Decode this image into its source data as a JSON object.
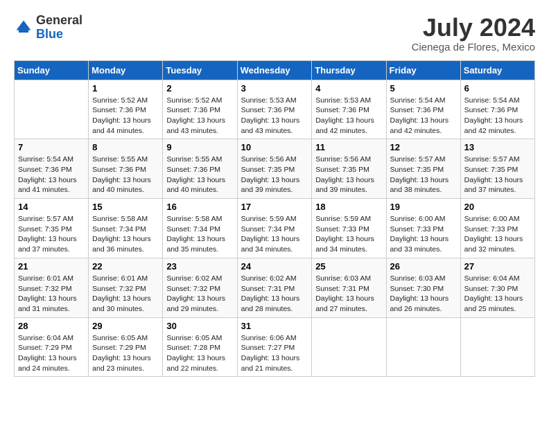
{
  "header": {
    "logo_general": "General",
    "logo_blue": "Blue",
    "month_year": "July 2024",
    "location": "Cienega de Flores, Mexico"
  },
  "days_of_week": [
    "Sunday",
    "Monday",
    "Tuesday",
    "Wednesday",
    "Thursday",
    "Friday",
    "Saturday"
  ],
  "weeks": [
    [
      {
        "num": "",
        "info": ""
      },
      {
        "num": "1",
        "info": "Sunrise: 5:52 AM\nSunset: 7:36 PM\nDaylight: 13 hours\nand 44 minutes."
      },
      {
        "num": "2",
        "info": "Sunrise: 5:52 AM\nSunset: 7:36 PM\nDaylight: 13 hours\nand 43 minutes."
      },
      {
        "num": "3",
        "info": "Sunrise: 5:53 AM\nSunset: 7:36 PM\nDaylight: 13 hours\nand 43 minutes."
      },
      {
        "num": "4",
        "info": "Sunrise: 5:53 AM\nSunset: 7:36 PM\nDaylight: 13 hours\nand 42 minutes."
      },
      {
        "num": "5",
        "info": "Sunrise: 5:54 AM\nSunset: 7:36 PM\nDaylight: 13 hours\nand 42 minutes."
      },
      {
        "num": "6",
        "info": "Sunrise: 5:54 AM\nSunset: 7:36 PM\nDaylight: 13 hours\nand 42 minutes."
      }
    ],
    [
      {
        "num": "7",
        "info": "Sunrise: 5:54 AM\nSunset: 7:36 PM\nDaylight: 13 hours\nand 41 minutes."
      },
      {
        "num": "8",
        "info": "Sunrise: 5:55 AM\nSunset: 7:36 PM\nDaylight: 13 hours\nand 40 minutes."
      },
      {
        "num": "9",
        "info": "Sunrise: 5:55 AM\nSunset: 7:36 PM\nDaylight: 13 hours\nand 40 minutes."
      },
      {
        "num": "10",
        "info": "Sunrise: 5:56 AM\nSunset: 7:35 PM\nDaylight: 13 hours\nand 39 minutes."
      },
      {
        "num": "11",
        "info": "Sunrise: 5:56 AM\nSunset: 7:35 PM\nDaylight: 13 hours\nand 39 minutes."
      },
      {
        "num": "12",
        "info": "Sunrise: 5:57 AM\nSunset: 7:35 PM\nDaylight: 13 hours\nand 38 minutes."
      },
      {
        "num": "13",
        "info": "Sunrise: 5:57 AM\nSunset: 7:35 PM\nDaylight: 13 hours\nand 37 minutes."
      }
    ],
    [
      {
        "num": "14",
        "info": "Sunrise: 5:57 AM\nSunset: 7:35 PM\nDaylight: 13 hours\nand 37 minutes."
      },
      {
        "num": "15",
        "info": "Sunrise: 5:58 AM\nSunset: 7:34 PM\nDaylight: 13 hours\nand 36 minutes."
      },
      {
        "num": "16",
        "info": "Sunrise: 5:58 AM\nSunset: 7:34 PM\nDaylight: 13 hours\nand 35 minutes."
      },
      {
        "num": "17",
        "info": "Sunrise: 5:59 AM\nSunset: 7:34 PM\nDaylight: 13 hours\nand 34 minutes."
      },
      {
        "num": "18",
        "info": "Sunrise: 5:59 AM\nSunset: 7:33 PM\nDaylight: 13 hours\nand 34 minutes."
      },
      {
        "num": "19",
        "info": "Sunrise: 6:00 AM\nSunset: 7:33 PM\nDaylight: 13 hours\nand 33 minutes."
      },
      {
        "num": "20",
        "info": "Sunrise: 6:00 AM\nSunset: 7:33 PM\nDaylight: 13 hours\nand 32 minutes."
      }
    ],
    [
      {
        "num": "21",
        "info": "Sunrise: 6:01 AM\nSunset: 7:32 PM\nDaylight: 13 hours\nand 31 minutes."
      },
      {
        "num": "22",
        "info": "Sunrise: 6:01 AM\nSunset: 7:32 PM\nDaylight: 13 hours\nand 30 minutes."
      },
      {
        "num": "23",
        "info": "Sunrise: 6:02 AM\nSunset: 7:32 PM\nDaylight: 13 hours\nand 29 minutes."
      },
      {
        "num": "24",
        "info": "Sunrise: 6:02 AM\nSunset: 7:31 PM\nDaylight: 13 hours\nand 28 minutes."
      },
      {
        "num": "25",
        "info": "Sunrise: 6:03 AM\nSunset: 7:31 PM\nDaylight: 13 hours\nand 27 minutes."
      },
      {
        "num": "26",
        "info": "Sunrise: 6:03 AM\nSunset: 7:30 PM\nDaylight: 13 hours\nand 26 minutes."
      },
      {
        "num": "27",
        "info": "Sunrise: 6:04 AM\nSunset: 7:30 PM\nDaylight: 13 hours\nand 25 minutes."
      }
    ],
    [
      {
        "num": "28",
        "info": "Sunrise: 6:04 AM\nSunset: 7:29 PM\nDaylight: 13 hours\nand 24 minutes."
      },
      {
        "num": "29",
        "info": "Sunrise: 6:05 AM\nSunset: 7:29 PM\nDaylight: 13 hours\nand 23 minutes."
      },
      {
        "num": "30",
        "info": "Sunrise: 6:05 AM\nSunset: 7:28 PM\nDaylight: 13 hours\nand 22 minutes."
      },
      {
        "num": "31",
        "info": "Sunrise: 6:06 AM\nSunset: 7:27 PM\nDaylight: 13 hours\nand 21 minutes."
      },
      {
        "num": "",
        "info": ""
      },
      {
        "num": "",
        "info": ""
      },
      {
        "num": "",
        "info": ""
      }
    ]
  ]
}
